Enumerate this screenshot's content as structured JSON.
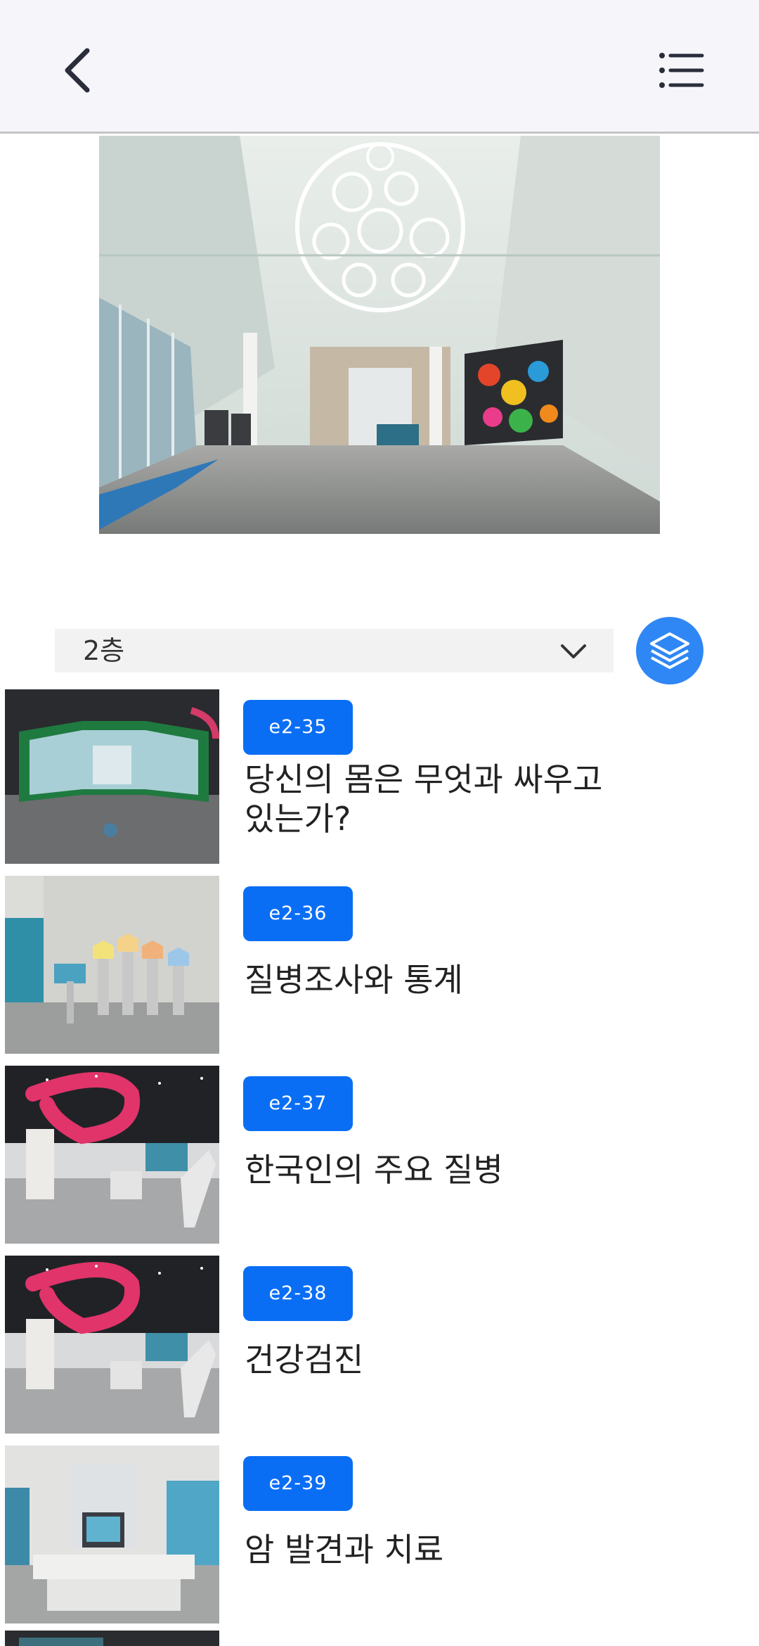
{
  "header": {
    "back_icon": "chevron-left-icon",
    "menu_icon": "list-menu-icon"
  },
  "floor_selector": {
    "selected": "2층",
    "layer_icon": "layers-icon"
  },
  "colors": {
    "accent": "#0a6ef5",
    "layer_button": "#2f87f5",
    "header_bg": "#f6f6fa"
  },
  "exhibits": [
    {
      "code": "e2-35",
      "title": "당신의 몸은 무엇과 싸우고 있는가?"
    },
    {
      "code": "e2-36",
      "title": "질병조사와 통계"
    },
    {
      "code": "e2-37",
      "title": "한국인의 주요 질병"
    },
    {
      "code": "e2-38",
      "title": "건강검진"
    },
    {
      "code": "e2-39",
      "title": "암 발견과 치료"
    }
  ]
}
